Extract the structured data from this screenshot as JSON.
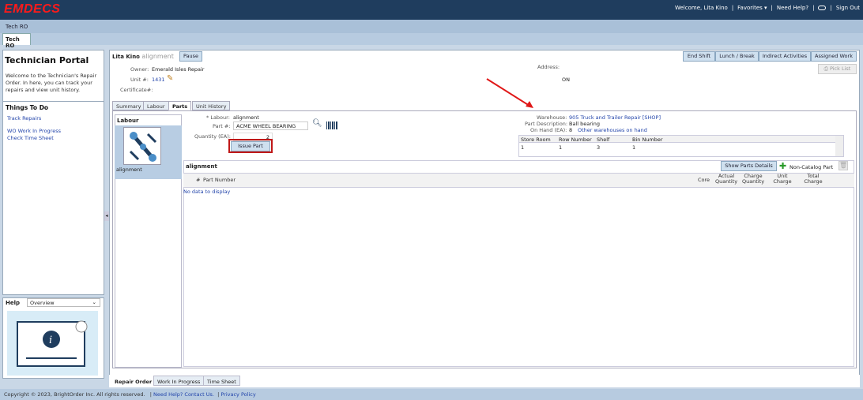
{
  "app": {
    "logo": "EMDECS"
  },
  "usernav": {
    "welcome": "Welcome, Lita Kino",
    "favorites": "Favorites ▾",
    "help": "Need Help?",
    "signout": "Sign Out"
  },
  "tabs": {
    "strip_label": "Tech RO",
    "active": "Tech RO"
  },
  "portal": {
    "title": "Technician Portal",
    "description": "Welcome to the Technician's Repair Order. In here, you can track your repairs and view unit history.",
    "things_title": "Things To Do",
    "todos": [
      "Track Repairs",
      "WO Work In Progress",
      "Check Time Sheet"
    ]
  },
  "help": {
    "title": "Help",
    "selected": "Overview"
  },
  "ro": {
    "tech": "Lita Kino",
    "title": "- alignment",
    "pause": "Pause",
    "owner_label": "Owner:",
    "owner": "Emerald Isles Repair",
    "unit_label": "Unit #:",
    "unit": "1431",
    "cert_label": "Certificate#:",
    "address_label": "Address:",
    "address": "ON"
  },
  "actions": [
    "End Shift",
    "Lunch / Break",
    "Indirect Activities",
    "Assigned Work"
  ],
  "pick_list": "Pick List",
  "subtabs": [
    "Summary",
    "Labour",
    "Parts",
    "Unit History"
  ],
  "labour": {
    "heading": "Labour",
    "item": "alignment"
  },
  "parts_form": {
    "labour_label": "* Labour:",
    "labour": "alignment",
    "part_label": "Part #:",
    "part": "ACME WHEEL BEARING",
    "qty_label": "Quantity (EA):",
    "qty": "2",
    "issue": "Issue Part"
  },
  "warehouse": {
    "wh_label": "Warehouse:",
    "wh": "905 Truck and Trailer Repair [SHOP]",
    "desc_label": "Part Description:",
    "desc": "Ball bearing",
    "onhand_label": "On Hand (EA):",
    "onhand": "8",
    "other": "Other warehouses on hand"
  },
  "stock": {
    "headers": [
      "Store Room",
      "Row Number",
      "Shelf",
      "Bin Number"
    ],
    "row": [
      "1",
      "1",
      "3",
      "1"
    ]
  },
  "grid": {
    "title": "alignment",
    "show_details": "Show Parts Details",
    "non_catalog": "Non-Catalog Part",
    "headers": [
      "#",
      "Part Number",
      "Core",
      "Actual Quantity",
      "Charge Quantity",
      "Unit Charge",
      "Total Charge"
    ],
    "empty": "No data to display"
  },
  "bottom_tabs": [
    "Repair Order",
    "Work In Progress",
    "Time Sheet"
  ],
  "footer": {
    "copyright": "Copyright © 2023, BrightOrder Inc. All rights reserved.",
    "contact": "Need Help? Contact Us.",
    "privacy": "Privacy Policy"
  },
  "colors": {
    "topbar": "#1f3d5e",
    "logo": "#ff1a1a",
    "highlight": "#c01818",
    "link": "#2244aa"
  }
}
